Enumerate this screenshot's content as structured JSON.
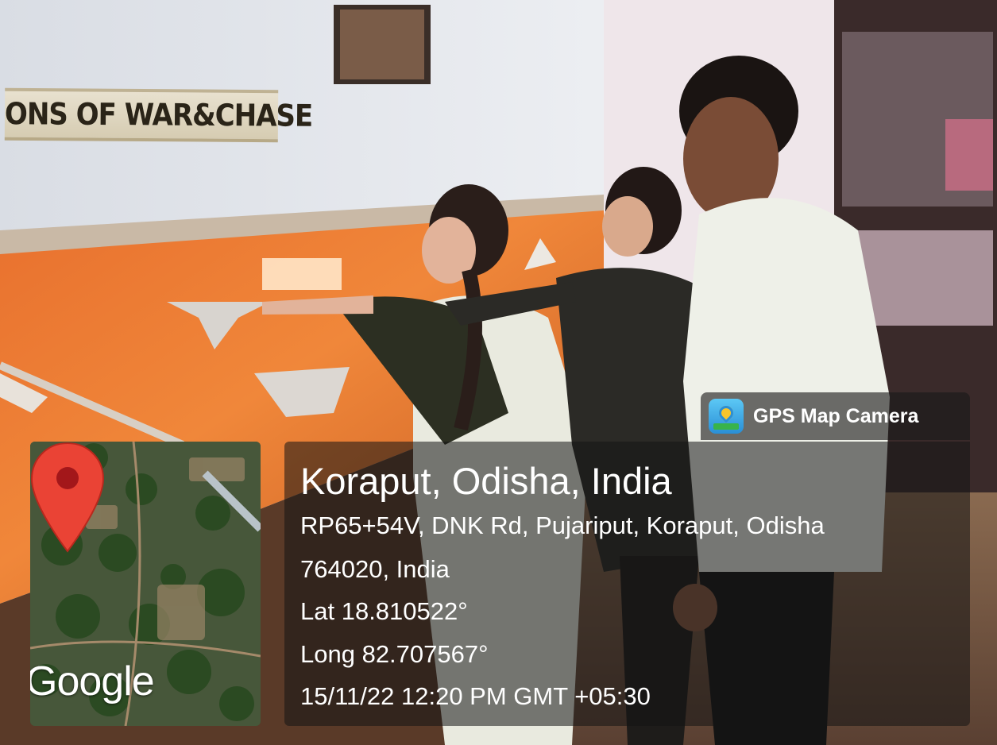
{
  "scene": {
    "sign_text": "ONS OF WAR&CHASE"
  },
  "map_thumbnail": {
    "provider_logo": "Google",
    "marker_icon": "map-pin-icon"
  },
  "badge": {
    "app_icon": "gps-map-camera-icon",
    "app_name": "GPS Map Camera"
  },
  "location": {
    "title": "Koraput, Odisha, India",
    "address_line1": "RP65+54V, DNK Rd, Pujariput, Koraput, Odisha",
    "address_line2": "764020, India",
    "latitude": "Lat 18.810522°",
    "longitude": "Long 82.707567°",
    "timestamp": "15/11/22 12:20 PM GMT +05:30"
  },
  "colors": {
    "overlay": "#141414",
    "text": "#ffffff",
    "pin": "#ea4335"
  }
}
